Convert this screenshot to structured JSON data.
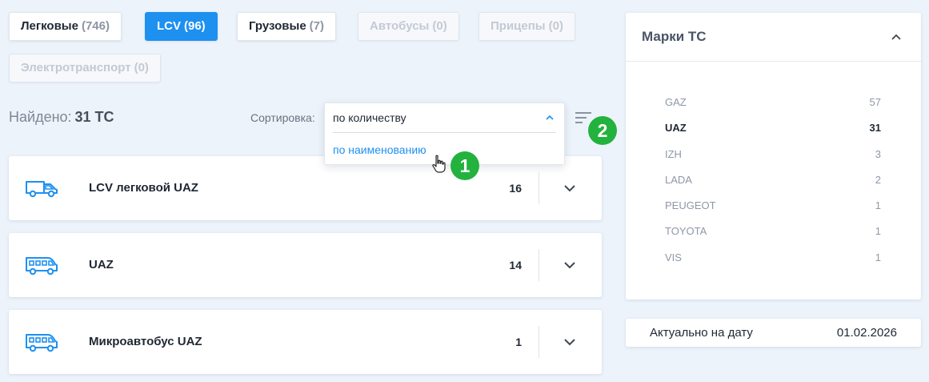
{
  "tabs": [
    {
      "label": "Легковые",
      "count": "(746)"
    },
    {
      "label": "LCV",
      "count": "(96)"
    },
    {
      "label": "Грузовые",
      "count": "(7)"
    },
    {
      "label": "Автобусы",
      "count": "(0)"
    },
    {
      "label": "Прицепы",
      "count": "(0)"
    },
    {
      "label": "Электротранспорт",
      "count": "(0)"
    }
  ],
  "active_tab": "LCV",
  "found": {
    "label": "Найдено:",
    "value": "31 ТС"
  },
  "sort": {
    "label": "Сортировка:",
    "selected": "по количеству",
    "options": [
      "по наименованию"
    ]
  },
  "badges": [
    "1",
    "2"
  ],
  "cards": [
    {
      "title": "LCV легковой UAZ",
      "count": "16",
      "icon": "van-icon"
    },
    {
      "title": "UAZ",
      "count": "14",
      "icon": "minibus-icon"
    },
    {
      "title": "Микроавтобус UAZ",
      "count": "1",
      "icon": "minibus-icon"
    }
  ],
  "brands": {
    "title": "Марки ТС",
    "items": [
      {
        "name": "GAZ",
        "count": "57"
      },
      {
        "name": "UAZ",
        "count": "31"
      },
      {
        "name": "IZH",
        "count": "3"
      },
      {
        "name": "LADA",
        "count": "2"
      },
      {
        "name": "PEUGEOT",
        "count": "1"
      },
      {
        "name": "TOYOTA",
        "count": "1"
      },
      {
        "name": "VIS",
        "count": "1"
      }
    ],
    "selected": "UAZ"
  },
  "date": {
    "label": "Актуально на дату",
    "value": "01.02.2026"
  },
  "colors": {
    "accent": "#1e90f0",
    "badge": "#23b23e",
    "background": "#edf3fb",
    "muted_text": "#8e98a6"
  }
}
